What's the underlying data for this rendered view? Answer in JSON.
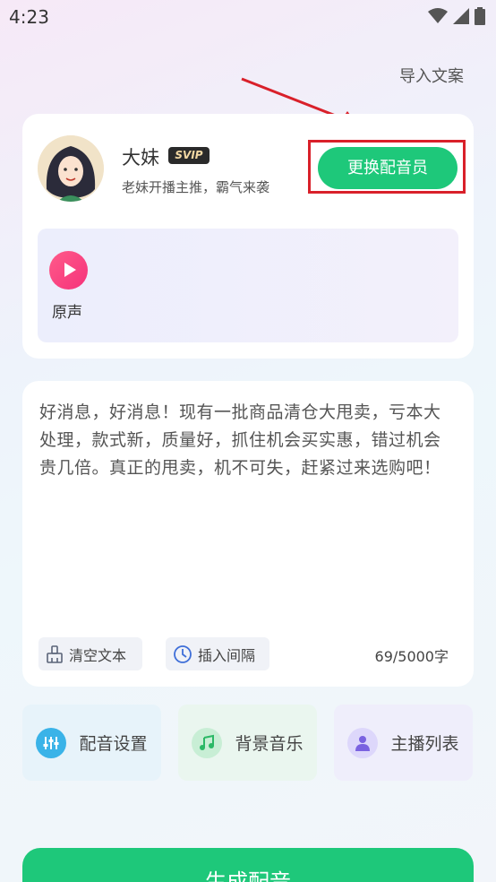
{
  "status": {
    "time": "4:23"
  },
  "header": {
    "import_label": "导入文案"
  },
  "voice": {
    "name": "大妹",
    "badge": "SVIP",
    "description": "老妹开播主推，霸气来袭",
    "change_label": "更换配音员",
    "sample_label": "原声"
  },
  "script": {
    "text": "好消息，好消息！现有一批商品清仓大甩卖，亏本大处理，款式新，质量好，抓住机会买实惠，错过机会贵几倍。真正的甩卖，机不可失，赶紧过来选购吧！",
    "clear_label": "清空文本",
    "interval_label": "插入间隔",
    "char_count": "69/5000字"
  },
  "functions": {
    "dub_settings": "配音设置",
    "bgm": "背景音乐",
    "anchor_list": "主播列表"
  },
  "generate_label": "生成配音",
  "colors": {
    "accent": "#1ec87a",
    "highlight": "#d9202a",
    "play": "#f5327a"
  }
}
